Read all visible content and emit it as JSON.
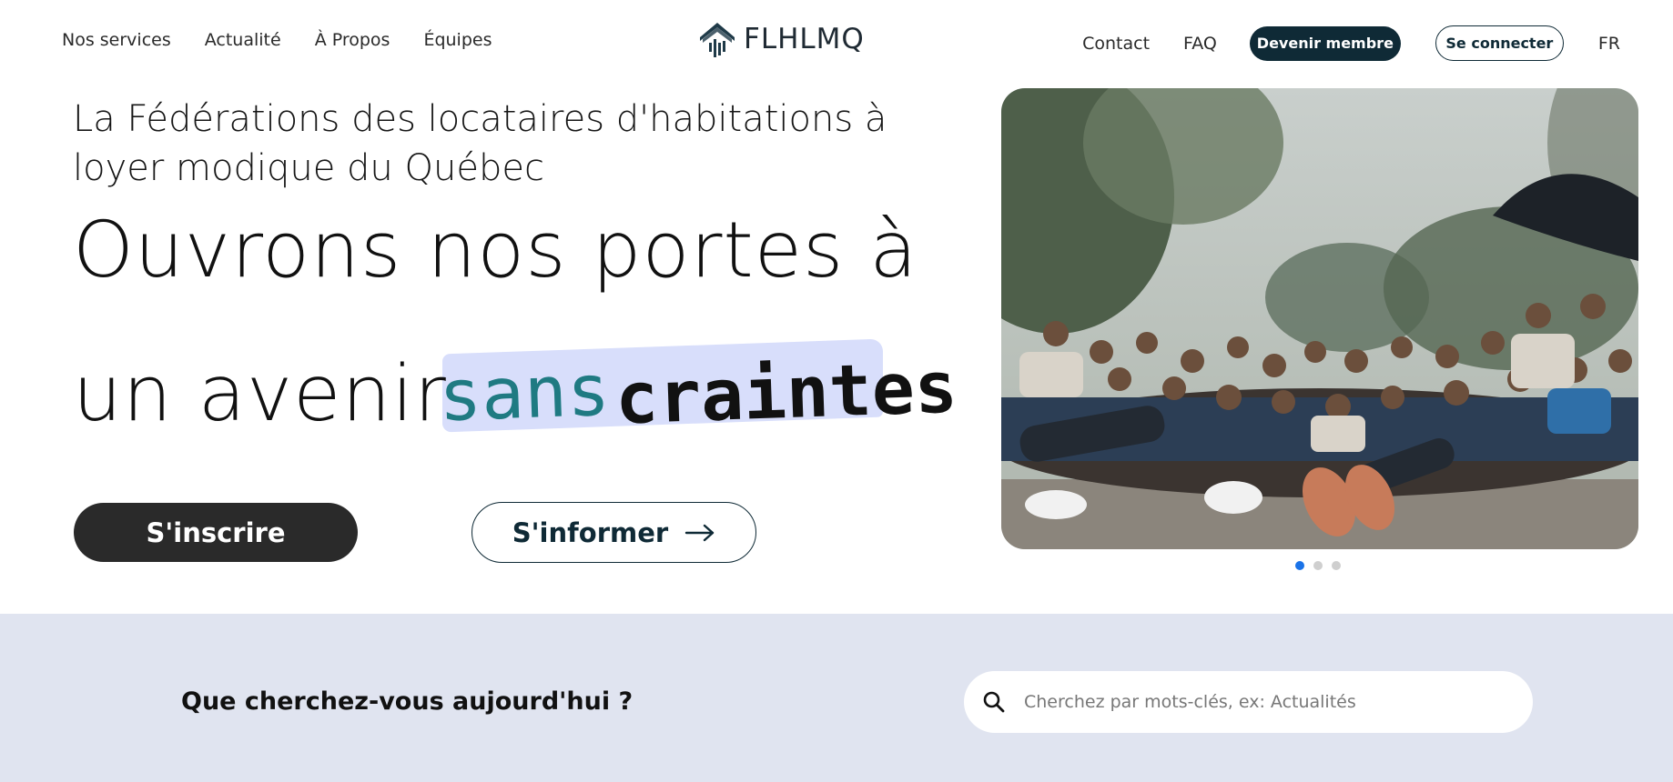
{
  "header": {
    "nav_left": [
      "Nos services",
      "Actualité",
      "À Propos",
      "Équipes"
    ],
    "logo_text": "FLHLMQ",
    "nav_right": {
      "contact": "Contact",
      "faq": "FAQ",
      "member_button": "Devenir membre",
      "login_button": "Se connecter",
      "language": "FR"
    }
  },
  "hero": {
    "subtitle": "La Fédérations des locataires d'habitations à loyer modique du Québec",
    "headline_line1": "Ouvrons nos portes à",
    "headline_line2_prefix": "un avenir",
    "highlight_word1": "sans",
    "highlight_word2": "craintes",
    "signup_button": "S'inscrire",
    "info_button": "S'informer",
    "carousel": {
      "slide_count": 3,
      "active_slide": 1
    }
  },
  "search_section": {
    "title": "Que cherchez-vous aujourd'hui ?",
    "placeholder": "Cherchez par mots-clés, ex: Actualités"
  },
  "colors": {
    "brand_dark": "#0f2a36",
    "accent_teal": "#1f7a82",
    "highlight": "#d8defb",
    "band_bg": "#e0e4f0",
    "active_dot": "#1a73e8"
  }
}
